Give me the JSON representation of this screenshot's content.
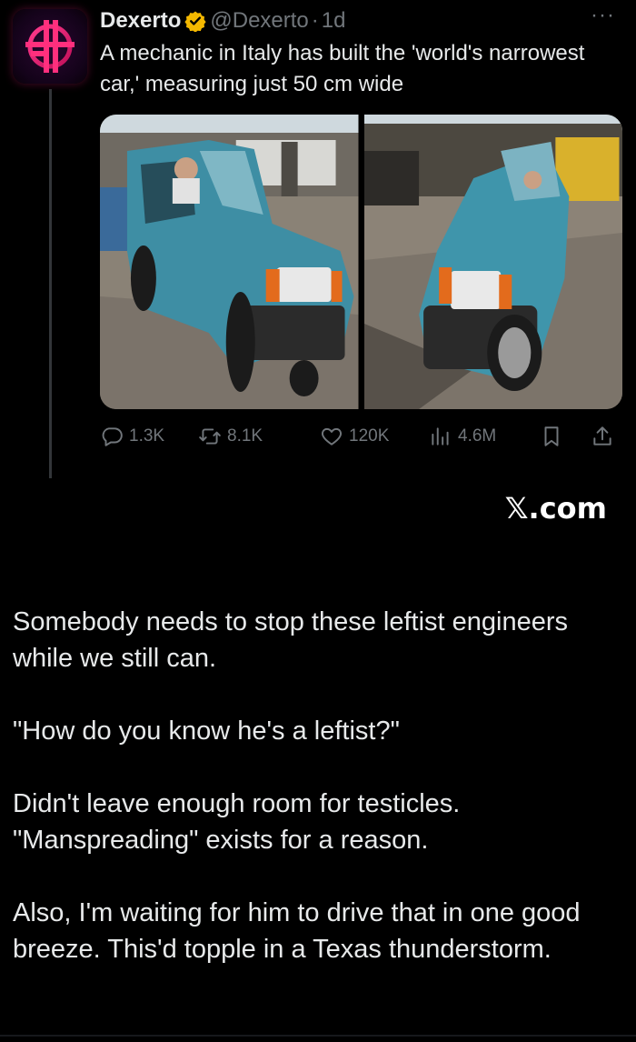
{
  "tweet": {
    "display_name": "Dexerto",
    "handle": "@Dexerto",
    "separator": "·",
    "time": "1d",
    "more_label": "···",
    "text": "A mechanic in Italy has built the 'world's narrowest car,' measuring just 50 cm wide",
    "verified_color": "#F4B800",
    "media": [
      {
        "icon": "narrow-car-front-left-photo"
      },
      {
        "icon": "narrow-car-front-right-photo"
      }
    ],
    "actions": {
      "replies": "1.3K",
      "retweets": "8.1K",
      "likes": "120K",
      "views": "4.6M"
    }
  },
  "watermark": "𝕏.com",
  "comment": {
    "paragraphs": [
      "Somebody needs to stop these leftist engineers while we still can.",
      "\"How do you know he's a leftist?\"",
      "Didn't leave enough room for testicles. \"Manspreading\" exists for a reason.",
      "Also, I'm waiting for him to drive that in one good breeze. This'd topple in a Texas thunderstorm."
    ]
  },
  "colors": {
    "background": "#000000",
    "text": "#E7E9EA",
    "muted": "#71767B",
    "brand_pink": "#E0126A"
  }
}
